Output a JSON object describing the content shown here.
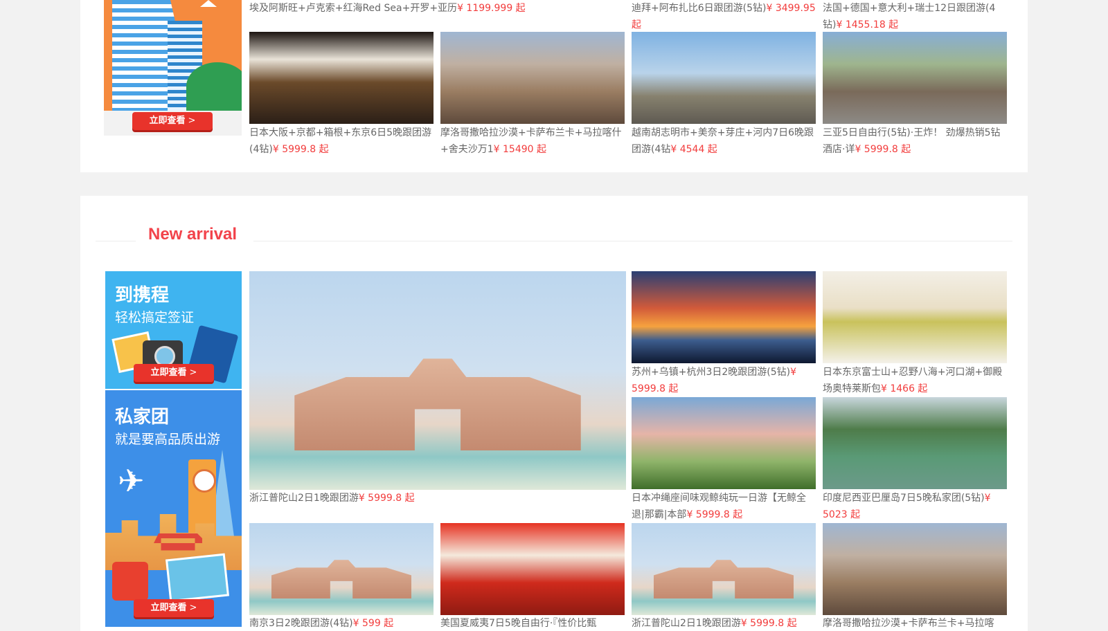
{
  "colors": {
    "accent": "#f2434b",
    "price": "#f23c3c",
    "visa_banner": "#3fb4f0",
    "private_banner": "#3d8fe8",
    "building_banner": "#f58a3e"
  },
  "top_section": {
    "banner": {
      "cta_label": "立即查看",
      "cta_chevron": ">"
    },
    "captions_row1": [
      {
        "text": "埃及阿斯旺+卢克索+红海Red Sea+开罗+亚历",
        "price": "¥ 1199.999 起"
      },
      {
        "text": "迪拜+阿布扎比6日跟团游(5钻)",
        "price": "¥ 3499.95 起"
      },
      {
        "text": "法国+德国+意大利+瑞士12日跟团游(4钻)",
        "price": "¥ 1455.18 起"
      }
    ],
    "products_row2": [
      {
        "text": "日本大阪+京都+箱根+东京6日5晚跟团游(4钻)",
        "price": "¥ 5999.8 起",
        "image": "lantern-photo"
      },
      {
        "text": "摩洛哥撒哈拉沙漠+卡萨布兰卡+马拉喀什+舍夫沙万1",
        "price": "¥ 15490 起",
        "image": "city-night-photo"
      },
      {
        "text": "越南胡志明市+美奈+芽庄+河内7日6晚跟团游(4钻",
        "price": "¥ 4544 起",
        "image": "torii-street-photo"
      },
      {
        "text": "三亚5日自由行(5钻)·王炸！ 劲爆热销5钻酒店·详",
        "price": "¥ 5999.8 起",
        "image": "old-street-photo"
      }
    ]
  },
  "new_arrival": {
    "title": "New arrival",
    "banners": [
      {
        "title": "到携程",
        "subtitle": "轻松搞定签证",
        "cta_label": "立即查看",
        "cta_chevron": ">"
      },
      {
        "title": "私家团",
        "subtitle": "就是要高品质出游",
        "cta_label": "立即查看",
        "cta_chevron": ">"
      }
    ],
    "featured": {
      "text": "浙江普陀山2日1晚跟团游",
      "price": "¥ 5999.8 起"
    },
    "grid_row1": [
      {
        "text": "苏州+乌镇+杭州3日2晚跟团游(5钻)",
        "price": "¥ 5999.8 起"
      },
      {
        "text": "日本东京富士山+忍野八海+河口湖+御殿场奥特莱斯包",
        "price": "¥ 1466 起"
      }
    ],
    "grid_row2": [
      {
        "text": "日本冲绳座间味观鲸纯玩一日游【无鲸全退|那霸|本部",
        "price": "¥ 5999.8 起"
      },
      {
        "text": "印度尼西亚巴厘岛7日5晚私家团(5钻)",
        "price": "¥ 5023 起"
      }
    ],
    "bottom_row": [
      {
        "text": "南京3日2晚跟团游(4钻)",
        "price": "¥ 599 起"
      },
      {
        "text": "美国夏威夷7日5晚自由行·『性价比甄",
        "price": ""
      },
      {
        "text": "浙江普陀山2日1晚跟团游",
        "price": "¥ 5999.8 起"
      },
      {
        "text": "摩洛哥撒哈拉沙漠+卡萨布兰卡+马拉喀",
        "price": ""
      }
    ]
  }
}
